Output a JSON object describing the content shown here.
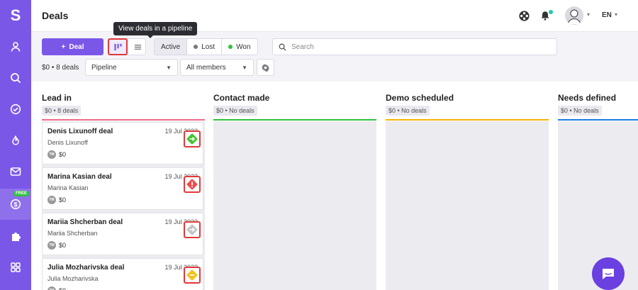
{
  "app": {
    "logo_letter": "S"
  },
  "sidebar": {
    "items": [
      {
        "name": "user-icon"
      },
      {
        "name": "search-icon"
      },
      {
        "name": "check-circle-icon"
      },
      {
        "name": "fire-icon"
      },
      {
        "name": "mail-icon"
      },
      {
        "name": "dollar-icon",
        "badge": "FREE",
        "active": true
      },
      {
        "name": "puzzle-icon"
      },
      {
        "name": "grid-icon"
      }
    ]
  },
  "header": {
    "title": "Deals",
    "language": "EN"
  },
  "toolbar": {
    "tooltip": "View deals in a pipeline",
    "add_deal_label": "Deal",
    "status_filters": [
      {
        "label": "Active",
        "active": true,
        "dot_color": ""
      },
      {
        "label": "Lost",
        "active": false,
        "dot_color": "#777777"
      },
      {
        "label": "Won",
        "active": false,
        "dot_color": "#2ec23a"
      }
    ],
    "search_placeholder": "Search",
    "summary": "$0 • 8 deals",
    "pipeline_select": "Pipeline",
    "members_select": "All members"
  },
  "columns": [
    {
      "title": "Lead in",
      "badge": "$0 • 8 deals",
      "color": "#f06b8a"
    },
    {
      "title": "Contact made",
      "badge": "$0 • No deals",
      "color": "#2ec23a"
    },
    {
      "title": "Demo scheduled",
      "badge": "$0 • No deals",
      "color": "#f5b400"
    },
    {
      "title": "Needs defined",
      "badge": "$0 • No deals",
      "color": "#1e7be0"
    }
  ],
  "deals": [
    {
      "title": "Denis Lixunoff deal",
      "date": "19 Jul 2022",
      "person": "Denis Lixunoff",
      "owner_initials": "TM",
      "amount": "$0",
      "status_icon": "arrow-right-icon",
      "status_color": "#41c52b"
    },
    {
      "title": "Marina Kasian deal",
      "date": "19 Jul 2022",
      "person": "Marina Kasian",
      "owner_initials": "TM",
      "amount": "$0",
      "status_icon": "exclamation-icon",
      "status_color": "#ec4d4d"
    },
    {
      "title": "Mariia Shcherban deal",
      "date": "19 Jul 2022",
      "person": "Mariia Shcherban",
      "owner_initials": "TM",
      "amount": "$0",
      "status_icon": "arrow-right-icon",
      "status_color": "#c4c4c4"
    },
    {
      "title": "Julia Mozharivska deal",
      "date": "19 Jul 2022",
      "person": "Julia Mozharivska",
      "owner_initials": "TM",
      "amount": "$0",
      "status_icon": "minus-icon",
      "status_color": "#f5c21a"
    }
  ]
}
